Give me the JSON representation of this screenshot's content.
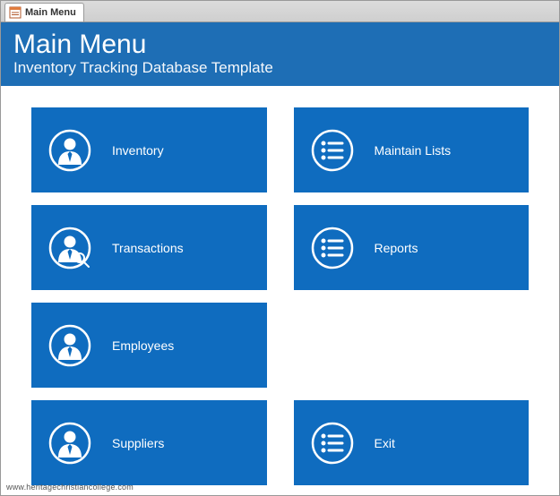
{
  "tab": {
    "label": "Main Menu"
  },
  "header": {
    "title": "Main Menu",
    "subtitle": "Inventory Tracking Database Template"
  },
  "tiles": {
    "left": [
      {
        "label": "Inventory",
        "icon": "person-icon",
        "name": "tile-inventory"
      },
      {
        "label": "Transactions",
        "icon": "person-search-icon",
        "name": "tile-transactions"
      },
      {
        "label": "Employees",
        "icon": "person-icon",
        "name": "tile-employees"
      },
      {
        "label": "Suppliers",
        "icon": "person-icon",
        "name": "tile-suppliers"
      }
    ],
    "right": [
      {
        "label": "Maintain Lists",
        "icon": "list-icon",
        "name": "tile-maintain-lists"
      },
      {
        "label": "Reports",
        "icon": "list-icon",
        "name": "tile-reports"
      },
      {
        "label": "",
        "icon": "",
        "name": "spacer",
        "spacer": true
      },
      {
        "label": "Exit",
        "icon": "list-icon",
        "name": "tile-exit"
      }
    ]
  },
  "watermark": "www.heritagechristiancollege.com"
}
